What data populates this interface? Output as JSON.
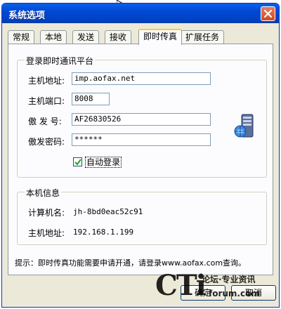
{
  "window": {
    "title": "系统选项"
  },
  "tabs": [
    {
      "label": "常规"
    },
    {
      "label": "本地"
    },
    {
      "label": "发送"
    },
    {
      "label": "接收"
    },
    {
      "label": "即时传真",
      "active": true
    },
    {
      "label": "扩展任务"
    }
  ],
  "login_group": {
    "title": "登录即时通讯平台",
    "host_label": "主机地址:",
    "host_value": "imp.aofax.net",
    "port_label": "主机端口:",
    "port_value": "8008",
    "sender_label": "傲 发 号:",
    "sender_value": "AF26830526",
    "password_label": "傲发密码:",
    "password_value": "******",
    "auto_login_label": "自动登录",
    "auto_login_checked": true
  },
  "local_group": {
    "title": "本机信息",
    "computer_label": "计算机名:",
    "computer_value": "jh-8bd0eac52c91",
    "address_label": "主机地址:",
    "address_value": "192.168.1.199"
  },
  "hint": "提示：即时传真功能需要申请开通，请登录www.aofax.com查询。",
  "buttons": {
    "ok": "确定",
    "cancel": "取消"
  },
  "watermark": {
    "brand": "CTi",
    "top_text": "论坛·专业资讯",
    "bottom_text": "forum.com"
  },
  "colors": {
    "titlebar": "#0a5fe9",
    "window_bg": "#ece9d8",
    "close_button": "#d24a22",
    "active_tab_accent": "#ffc83c"
  }
}
